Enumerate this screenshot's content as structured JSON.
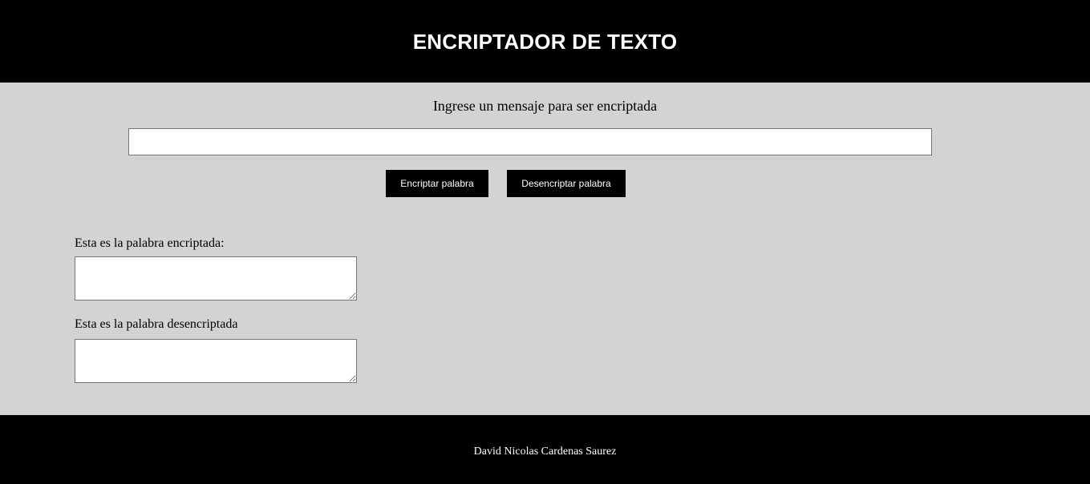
{
  "header": {
    "title": "ENCRIPTADOR DE TEXTO"
  },
  "main": {
    "prompt": "Ingrese un mensaje para ser encriptada",
    "message_input": {
      "value": "",
      "placeholder": ""
    },
    "buttons": {
      "encrypt_label": "Encriptar palabra",
      "decrypt_label": "Desencriptar palabra"
    },
    "encrypted_label": "Esta es la palabra encriptada:",
    "decrypted_label": "Esta es la palabra desencriptada",
    "encrypted_value": "",
    "decrypted_value": ""
  },
  "footer": {
    "author": "David Nicolas Cardenas Saurez"
  },
  "colors": {
    "header_bg": "#000000",
    "body_bg": "#d3d3d3",
    "button_bg": "#000000",
    "button_text": "#ffffff",
    "footer_bg": "#000000"
  }
}
